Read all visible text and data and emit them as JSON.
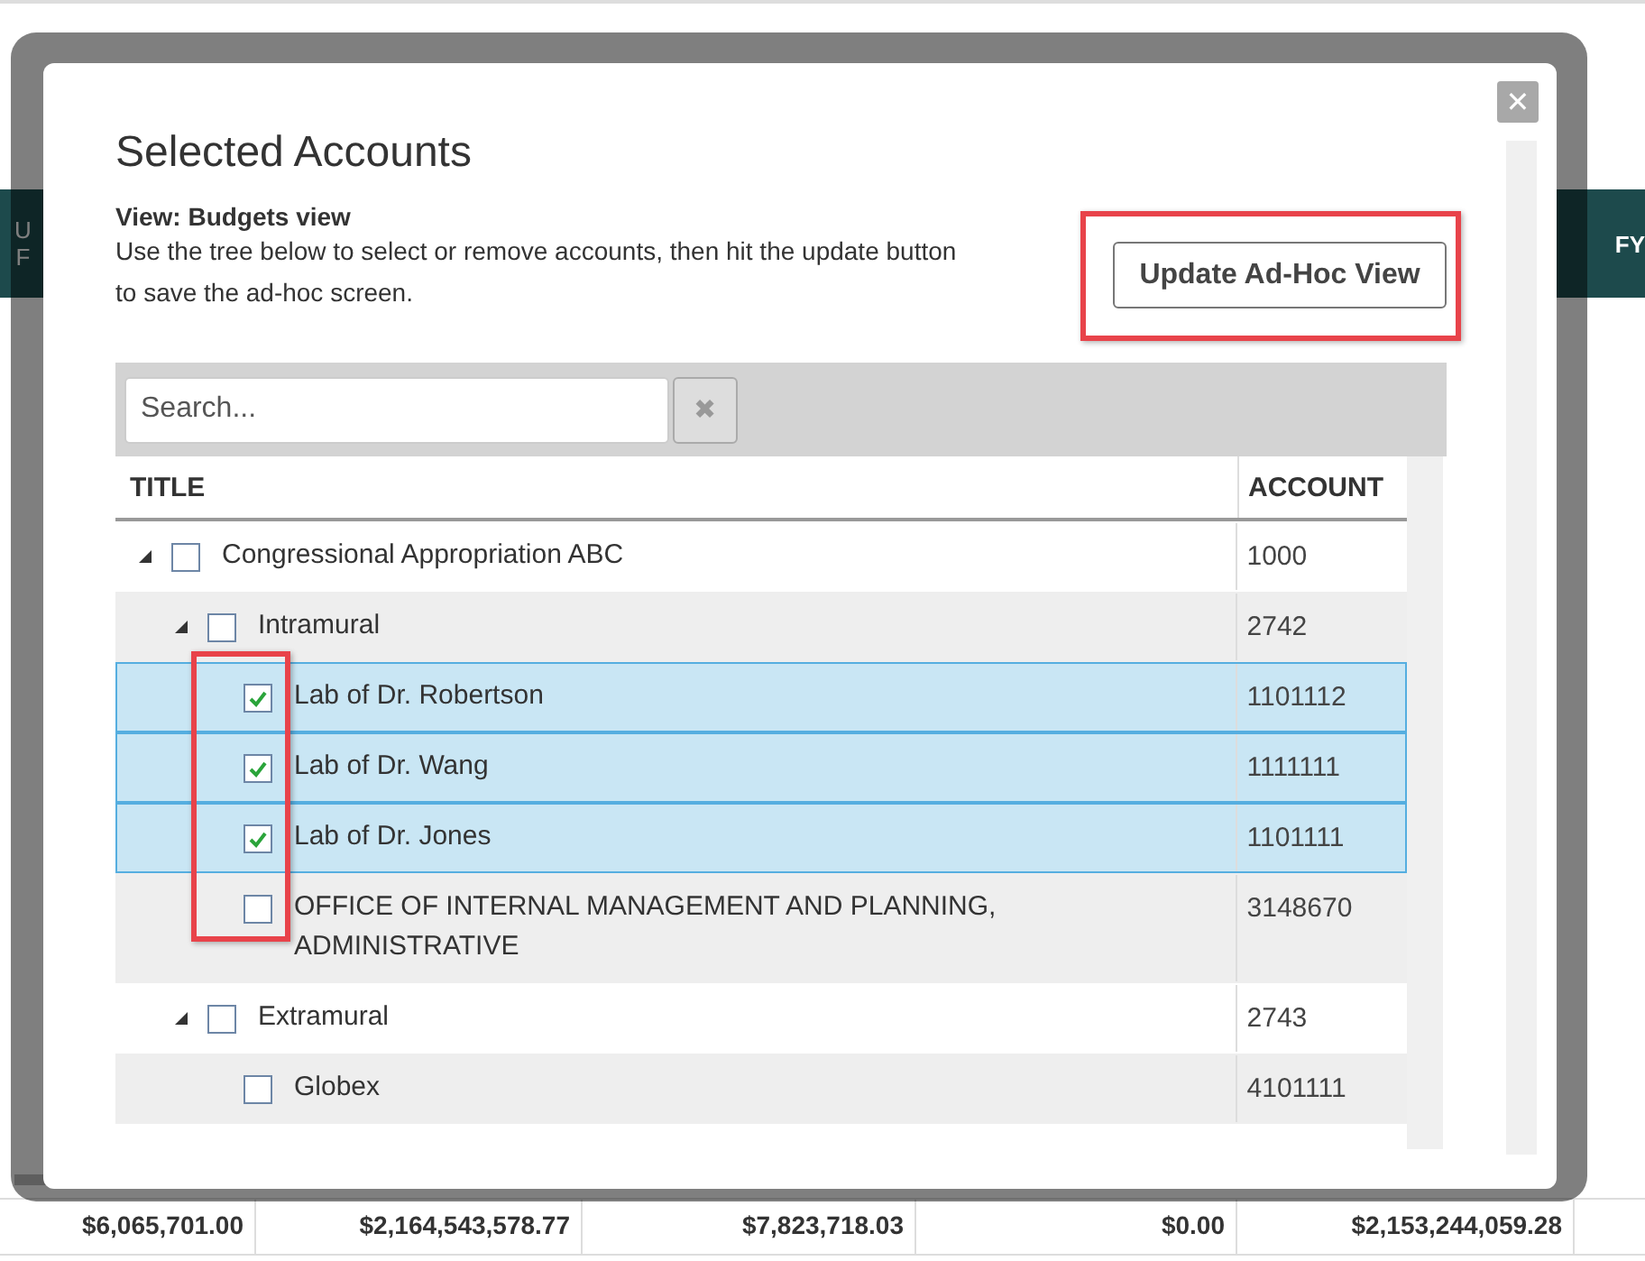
{
  "background": {
    "header_cells": [
      {
        "lines": [
          "U",
          "F"
        ]
      },
      {
        "lines": [
          "FY"
        ]
      }
    ],
    "totals": [
      "$6,065,701.00",
      "$2,164,543,578.77",
      "$7,823,718.03",
      "$0.00",
      "$2,153,244,059.28"
    ]
  },
  "dialog": {
    "title": "Selected Accounts",
    "close_label": "✕",
    "view_label": "View: Budgets view",
    "description": "Use the tree below to select or remove accounts, then hit the update button to save the ad-hoc screen.",
    "update_button": {
      "label": "Update Ad-Hoc View",
      "highlighted": true
    },
    "search": {
      "placeholder": "Search...",
      "clear_label": "✖"
    },
    "tree": {
      "columns": [
        "TITLE",
        "ACCOUNT"
      ],
      "checkbox_highlight": true,
      "rows": [
        {
          "title": "Congressional Appropriation ABC",
          "account": "1000",
          "checked": false,
          "expanded": true,
          "selected": false,
          "children": [
            {
              "title": "Intramural",
              "account": "2742",
              "checked": false,
              "expanded": true,
              "selected": false,
              "children": [
                {
                  "title": "Lab of Dr. Robertson",
                  "account": "1101112",
                  "checked": true,
                  "selected": true
                },
                {
                  "title": "Lab of Dr. Wang",
                  "account": "1111111",
                  "checked": true,
                  "selected": true
                },
                {
                  "title": "Lab of Dr. Jones",
                  "account": "1101111",
                  "checked": true,
                  "selected": true
                },
                {
                  "title": "OFFICE OF INTERNAL MANAGEMENT AND PLANNING, ADMINISTRATIVE",
                  "account": "3148670",
                  "checked": false,
                  "selected": false
                }
              ]
            },
            {
              "title": "Extramural",
              "account": "2743",
              "checked": false,
              "expanded": true,
              "selected": false,
              "children": [
                {
                  "title": "Globex",
                  "account": "4101111",
                  "checked": false,
                  "selected": false
                }
              ]
            }
          ]
        }
      ]
    }
  }
}
